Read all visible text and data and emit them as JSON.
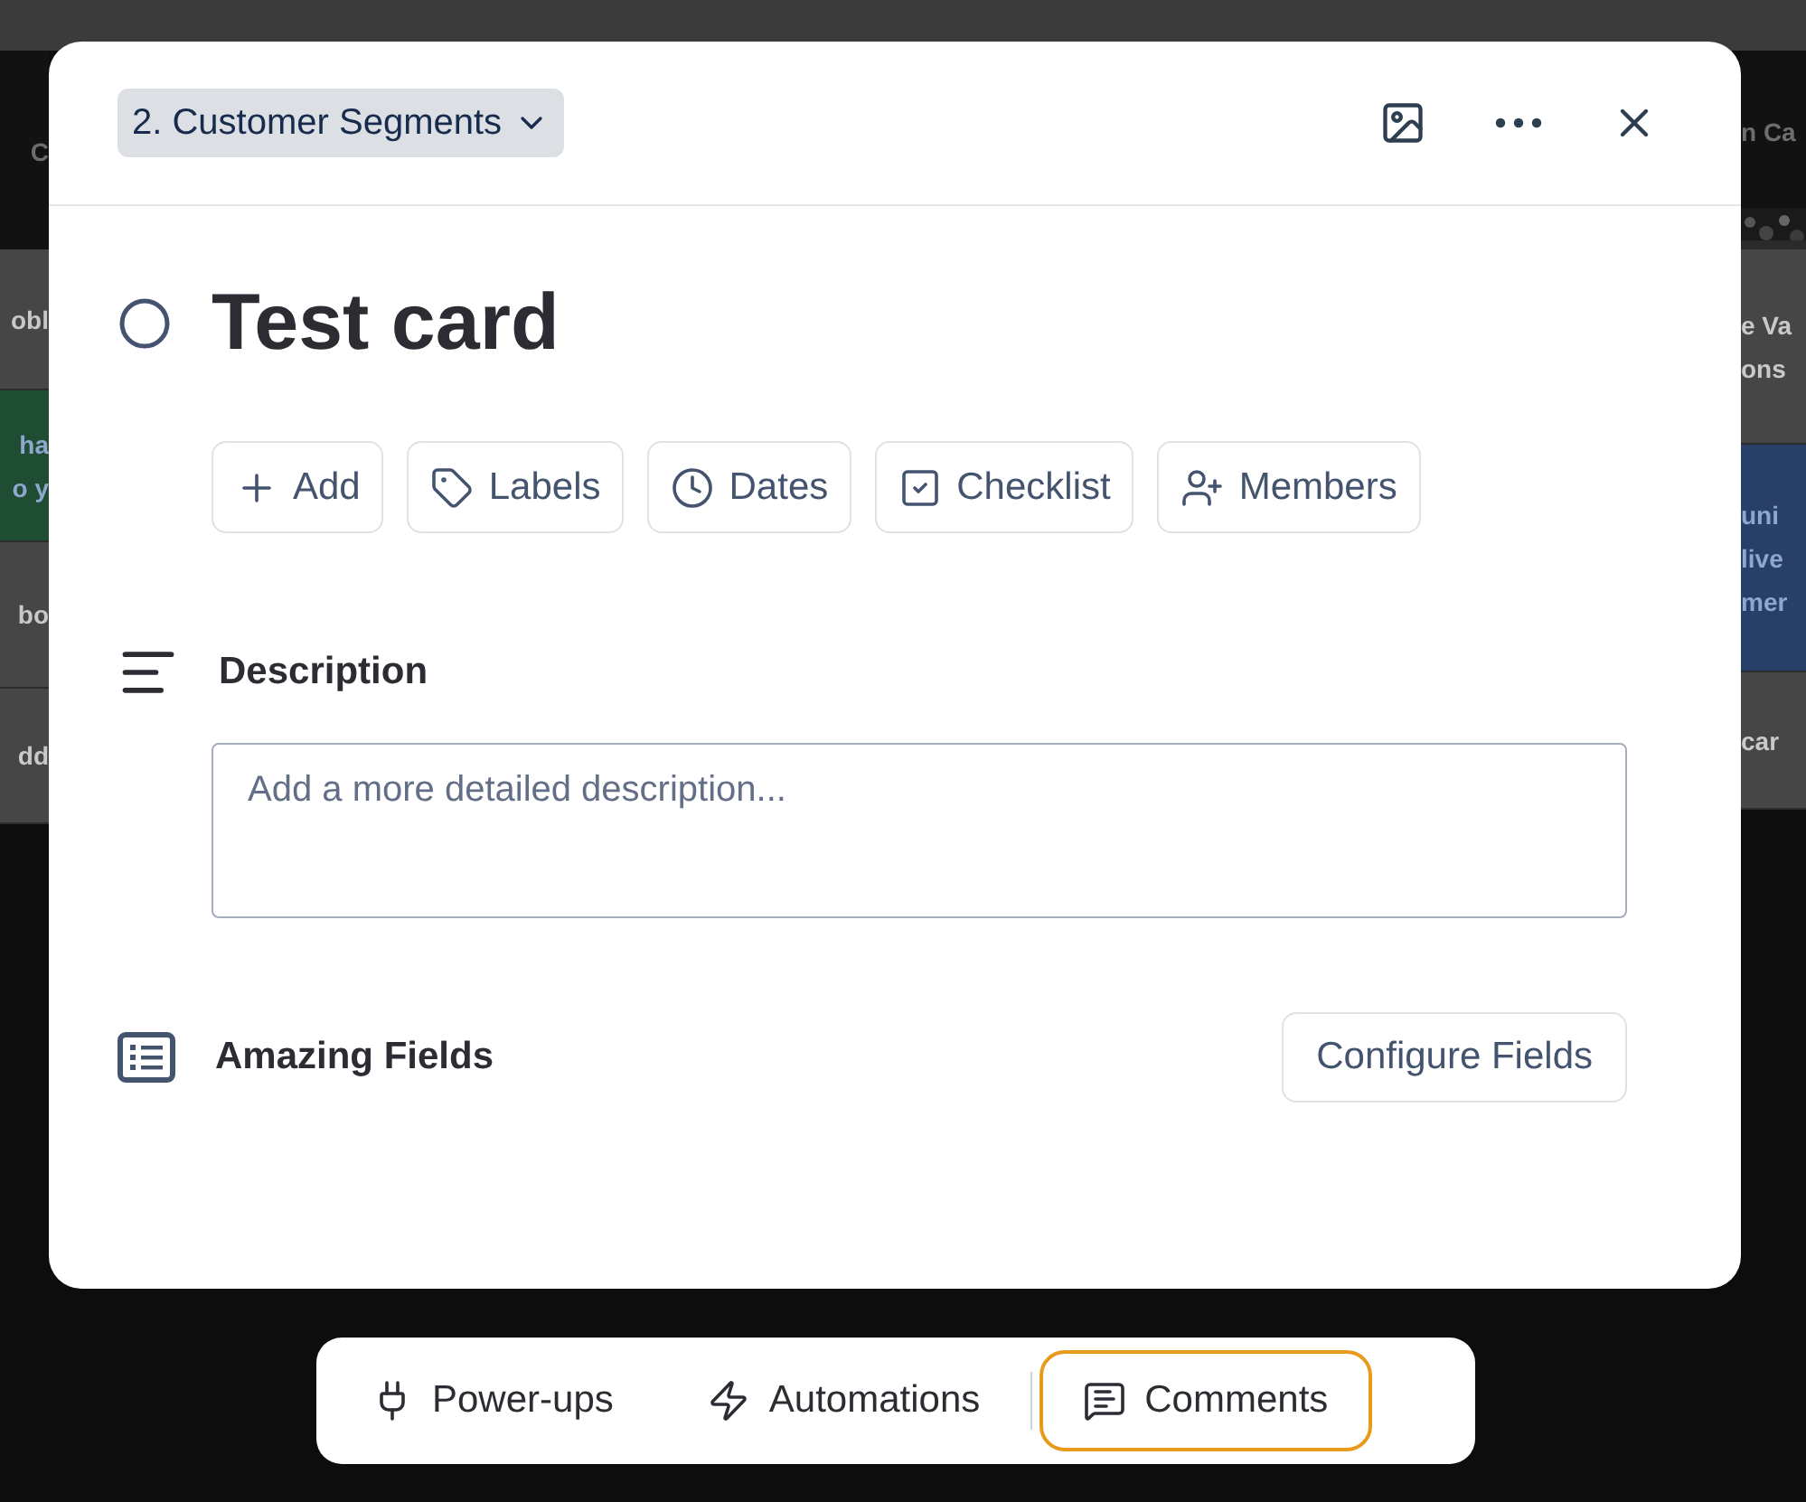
{
  "board": {
    "left_column": [
      {
        "kind": "header",
        "lines": [
          "C"
        ]
      },
      {
        "kind": "card",
        "lines": [
          "obl"
        ],
        "color": "#464646"
      },
      {
        "kind": "card",
        "lines": [
          "ha",
          "o y"
        ],
        "color": "#1f4d33"
      },
      {
        "kind": "card",
        "lines": [
          "bo"
        ],
        "color": "#464646"
      },
      {
        "kind": "card",
        "lines": [
          "dd"
        ],
        "color": "#464646"
      }
    ],
    "right_column": [
      {
        "kind": "header",
        "lines": [
          "n Ca"
        ]
      },
      {
        "kind": "cover"
      },
      {
        "kind": "card",
        "lines": [
          "e Va",
          "ons"
        ],
        "color": "#464646"
      },
      {
        "kind": "card",
        "lines": [
          "uni",
          "live",
          "mer"
        ],
        "color": "#283f68"
      },
      {
        "kind": "card",
        "lines": [
          "car"
        ],
        "color": "#464646"
      }
    ]
  },
  "card": {
    "list": "2. Customer Segments",
    "header_actions": [
      {
        "kind": "cover"
      },
      {
        "kind": "menu"
      },
      {
        "kind": "close"
      }
    ],
    "title": "Test card",
    "completed": false,
    "actions": [
      {
        "kind": "add",
        "label": "Add"
      },
      {
        "kind": "labels",
        "label": "Labels"
      },
      {
        "kind": "dates",
        "label": "Dates"
      },
      {
        "kind": "checklist",
        "label": "Checklist"
      },
      {
        "kind": "members",
        "label": "Members"
      }
    ],
    "description": {
      "heading": "Description",
      "placeholder": "Add a more detailed description..."
    },
    "fields": {
      "heading": "Amazing Fields",
      "button": "Configure Fields"
    }
  },
  "bottom_bar": [
    {
      "kind": "powerups",
      "label": "Power-ups",
      "selected": false
    },
    {
      "kind": "automations",
      "label": "Automations",
      "selected": false
    },
    {
      "kind": "comments",
      "label": "Comments",
      "selected": true
    }
  ]
}
